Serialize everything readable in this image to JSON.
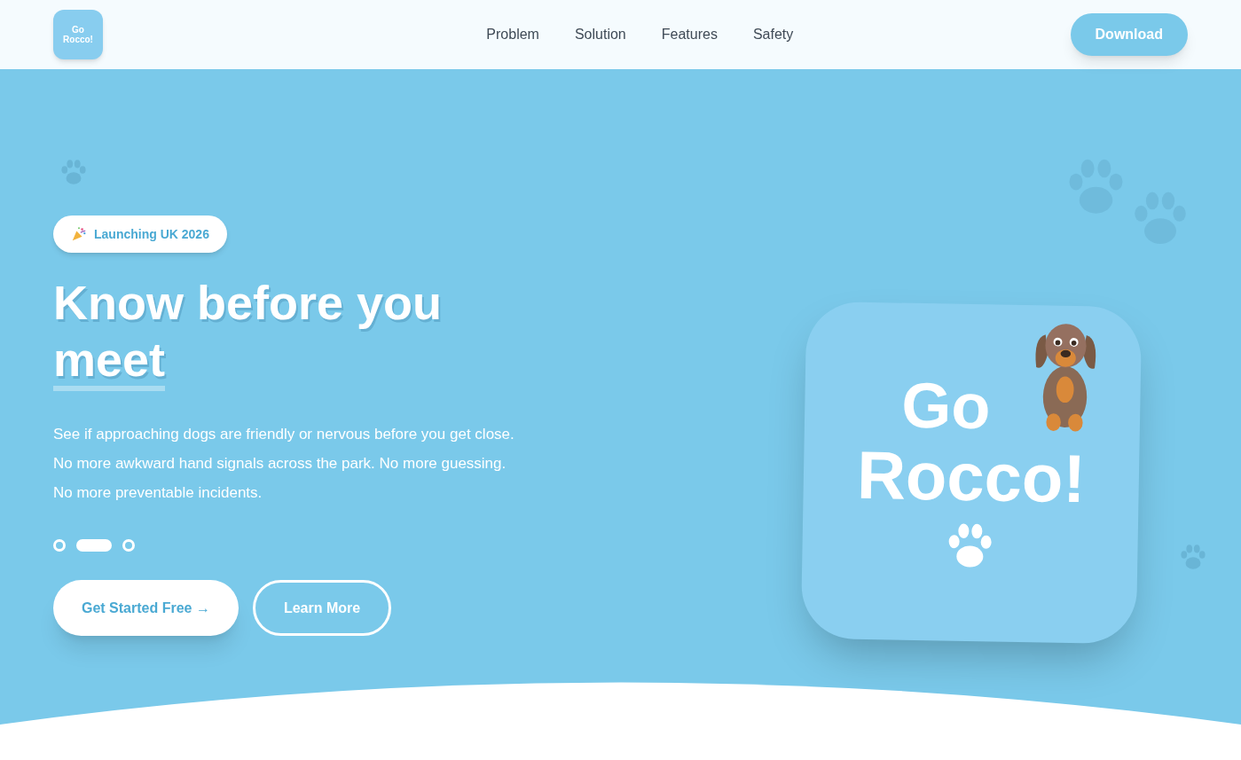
{
  "header": {
    "logo": {
      "lines": [
        "Go",
        "Rocco!"
      ]
    },
    "nav": [
      {
        "label": "Problem"
      },
      {
        "label": "Solution"
      },
      {
        "label": "Features"
      },
      {
        "label": "Safety"
      }
    ],
    "cta": "Download"
  },
  "hero": {
    "badge": "Launching UK 2026",
    "headline": {
      "text": "Know before you",
      "highlight": "meet"
    },
    "description_lines": [
      "See if approaching dogs are friendly or nervous before you get close.",
      "No more awkward hand signals across the park. No more guessing.",
      "No more preventable incidents."
    ],
    "slides": [
      {
        "selected": false
      },
      {
        "selected": true
      },
      {
        "selected": false
      }
    ],
    "buttons": [
      {
        "kind": "primary",
        "label": "Get Started Free →"
      },
      {
        "kind": "outline",
        "label": "Learn More"
      }
    ],
    "app_icon": {
      "lines": [
        "Go",
        "Rocco!"
      ]
    }
  }
}
